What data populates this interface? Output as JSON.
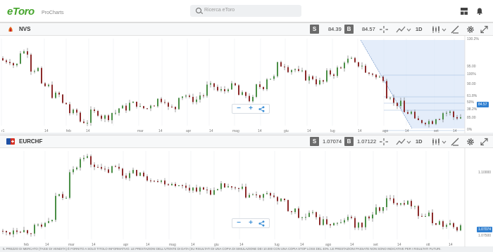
{
  "app": {
    "logo_text": "eToro",
    "product": "ProCharts"
  },
  "search": {
    "placeholder": "Ricerca eToro"
  },
  "top_icons": [
    "layout-icon",
    "notifications-icon"
  ],
  "panels": [
    {
      "symbol": "NVS",
      "sell_label": "S",
      "sell_price": "84.39",
      "buy_label": "B",
      "buy_price": "84.57",
      "timeframe": "1D",
      "current_price": "84.57",
      "x_axis": [
        "r1",
        "14",
        "feb",
        "14",
        "mar",
        "14",
        "apr",
        "14",
        "mag",
        "14",
        "giu",
        "14",
        "lug",
        "14",
        "ago",
        "14",
        "set",
        "14",
        "ott",
        "14"
      ],
      "y_axis": [
        "130.2%",
        "95.00",
        "100%",
        "90.00",
        "61.8%",
        "50%",
        "38.2%",
        "85.00",
        "0%"
      ],
      "fib_levels": [
        "100%",
        "61.8%",
        "50%",
        "38.2%",
        "0%"
      ],
      "y_range": [
        81,
        101
      ]
    },
    {
      "symbol": "EURCHF",
      "sell_label": "S",
      "sell_price": "1.07074",
      "buy_label": "B",
      "buy_price": "1.07122",
      "timeframe": "1D",
      "current_price": "1.07074",
      "x_axis": [
        "feb",
        "14",
        "mar",
        "14",
        "apr",
        "14",
        "mag",
        "14",
        "giu",
        "14",
        "lug",
        "14",
        "ago",
        "14",
        "set",
        "14",
        "ott",
        "14"
      ],
      "y_axis": [
        "1.10000",
        "1.07500"
      ],
      "y_range": [
        1.064,
        1.116
      ]
    }
  ],
  "footer": {
    "disclaimer": "IL PREZZO DI MERCATO (TASSI DI VENDITA) È FORNITO A SOLO TITOLO INFORMATIVO. LE PRESTAZIONI DELL'UTENTE DI DATA (SU RISULTATI DI UNA COPIA DI SIMULAZIONE DEI 10.000 CON UNA COPIA STOP LOSS DEL 40%. LE PRESTAZIONI PASSATE NON SONO INDICATIVE PER I RISULTATI FUTURI."
  },
  "colors": {
    "brand": "#46a52d",
    "up_candle": "#4a8f46",
    "down_candle": "#8c2a2a",
    "accent": "#3c8fd6",
    "badge": "#6b6b6b"
  }
}
